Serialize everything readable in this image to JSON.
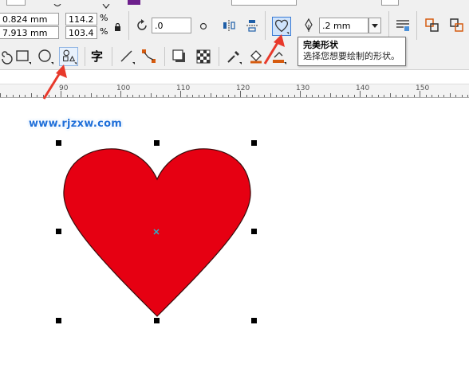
{
  "property_bar": {
    "width_value": "0.824 mm",
    "height_value": "7.913 mm",
    "scale_x": "114.2",
    "scale_y": "103.4",
    "percent_symbol": "%",
    "rotation_value": ".0",
    "outline_width": ".2 mm"
  },
  "tooltip": {
    "title": "完美形状",
    "description": "选择您想要绘制的形状。"
  },
  "toolbox": {
    "text_tool_label": "字"
  },
  "ruler": {
    "ticks": [
      "90",
      "100",
      "110",
      "120",
      "130",
      "140",
      "150"
    ]
  },
  "canvas": {
    "watermark": "www.rjzxw.com",
    "shape": "heart",
    "fill_color": "#e60012",
    "outline_color": "#000000"
  },
  "colors": {
    "toolbar_bg": "#f0f0f0",
    "arrow_red": "#e8392b",
    "highlight_blue": "#3a7bd5"
  }
}
